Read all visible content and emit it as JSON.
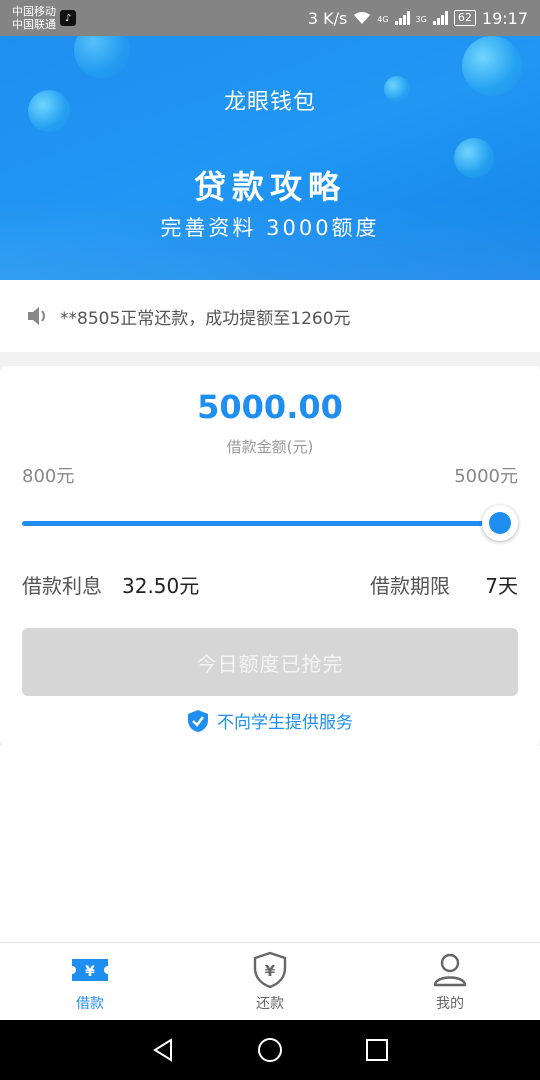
{
  "status_bar": {
    "carrier1": "中国移动",
    "carrier2": "中国联通",
    "network_speed": "3 K/s",
    "net_4g": "4G",
    "net_3g": "3G",
    "battery": "62",
    "time": "19:17"
  },
  "banner": {
    "app_title": "龙眼钱包",
    "hero_title": "贷款攻略",
    "hero_subtitle": "完善资料  3000额度"
  },
  "notice": {
    "text": "**8505正常还款，成功提额至1260元"
  },
  "loan_card": {
    "amount": "5000.00",
    "amount_label": "借款金额(元)",
    "range_min": "800元",
    "range_max": "5000元",
    "slider_level_percent": 100,
    "interest_label": "借款利息",
    "interest_value": "32.50元",
    "term_label": "借款期限",
    "term_value": "7天",
    "button_label": "今日额度已抢完",
    "student_notice": "不向学生提供服务"
  },
  "tabs": [
    {
      "label": "借款",
      "icon": "loan-ticket-icon",
      "active": true
    },
    {
      "label": "还款",
      "icon": "yen-shield-icon",
      "active": false
    },
    {
      "label": "我的",
      "icon": "user-icon",
      "active": false
    }
  ],
  "colors": {
    "accent": "#1e8ff0",
    "disabled_button": "#d6d6d6"
  }
}
